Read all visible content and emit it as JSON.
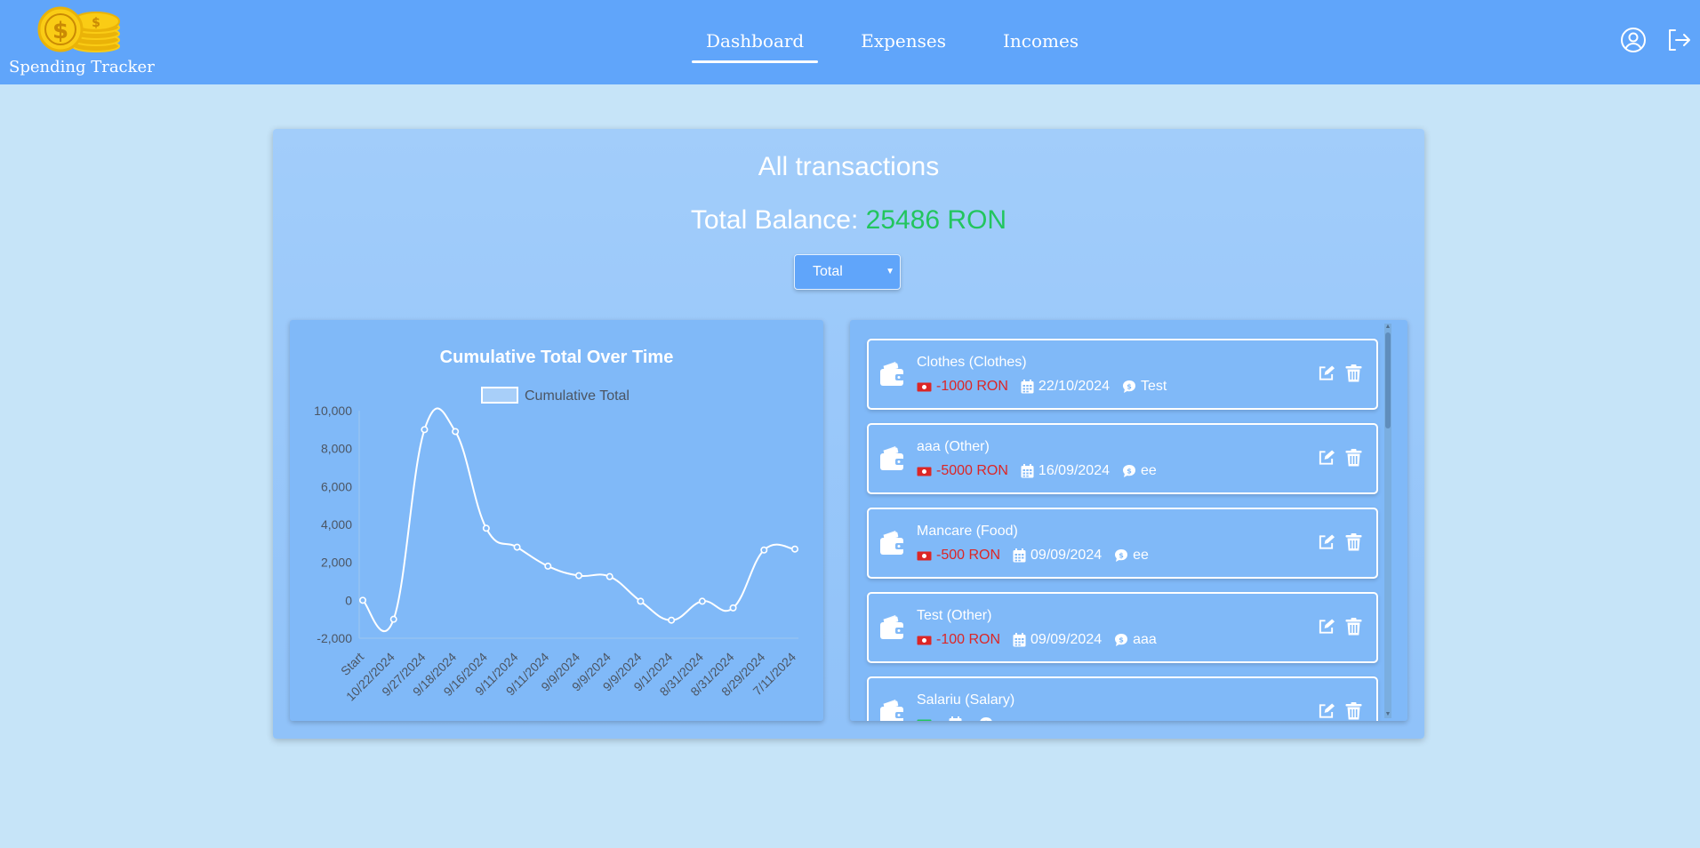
{
  "app": {
    "name": "Spending Tracker"
  },
  "nav": {
    "links": [
      {
        "label": "Dashboard",
        "active": true
      },
      {
        "label": "Expenses",
        "active": false
      },
      {
        "label": "Incomes",
        "active": false
      }
    ],
    "icons": [
      "user-circle-icon",
      "logout-icon"
    ]
  },
  "summary": {
    "title": "All transactions",
    "balance_label": "Total Balance:",
    "balance_value": "25486 RON",
    "filter_selected": "Total"
  },
  "colors": {
    "navbar": "#60a5fa",
    "background": "#c6e4f8",
    "negative": "#dc2626",
    "positive": "#22c55e",
    "logo": "#facc15"
  },
  "chart_data": {
    "type": "line",
    "title": "Cumulative Total Over Time",
    "legend": [
      "Cumulative Total"
    ],
    "legend_position": "top",
    "categories": [
      "Start",
      "10/22/2024",
      "9/27/2024",
      "9/18/2024",
      "9/16/2024",
      "9/11/2024",
      "9/11/2024",
      "9/9/2024",
      "9/9/2024",
      "9/9/2024",
      "9/1/2024",
      "8/31/2024",
      "8/31/2024",
      "8/29/2024",
      "7/11/2024"
    ],
    "series": [
      {
        "name": "Cumulative Total",
        "values": [
          0,
          -1000,
          9000,
          8900,
          3800,
          2800,
          1800,
          1300,
          1250,
          -50,
          -1050,
          -50,
          -400,
          2650,
          2700
        ]
      }
    ],
    "y_ticks": [
      "10,000",
      "8,000",
      "6,000",
      "4,000",
      "2,000",
      "0",
      "-2,000"
    ],
    "ylim": [
      -2000,
      10000
    ],
    "grid": false
  },
  "transactions": [
    {
      "title": "Clothes (Clothes)",
      "amount": "-1000 RON",
      "date": "22/10/2024",
      "note": "Test",
      "type": "expense"
    },
    {
      "title": "aaa (Other)",
      "amount": "-5000 RON",
      "date": "16/09/2024",
      "note": "ee",
      "type": "expense"
    },
    {
      "title": "Mancare (Food)",
      "amount": "-500 RON",
      "date": "09/09/2024",
      "note": "ee",
      "type": "expense"
    },
    {
      "title": "Test (Other)",
      "amount": "-100 RON",
      "date": "09/09/2024",
      "note": "aaa",
      "type": "expense"
    },
    {
      "title": "Salariu (Salary)",
      "amount": "",
      "date": "",
      "note": "",
      "type": "income"
    }
  ]
}
